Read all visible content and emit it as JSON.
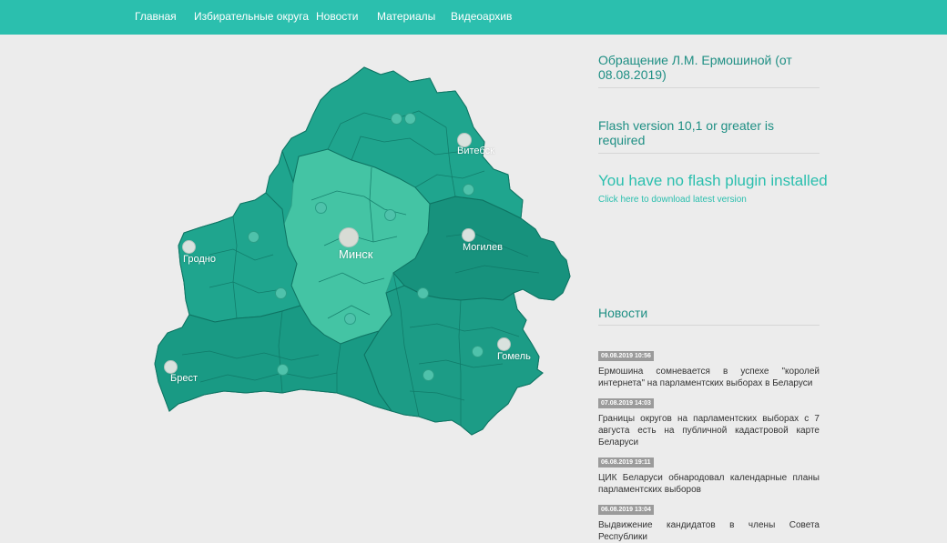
{
  "nav": {
    "items": [
      {
        "label": "Главная"
      },
      {
        "label": "Избирательные округа"
      },
      {
        "label": "Новости"
      },
      {
        "label": "Материалы"
      },
      {
        "label": "Видеоархив"
      }
    ]
  },
  "map": {
    "cities": [
      {
        "label": "Витебск"
      },
      {
        "label": "Могилев"
      },
      {
        "label": "Минск"
      },
      {
        "label": "Гродно"
      },
      {
        "label": "Брест"
      },
      {
        "label": "Гомель"
      }
    ],
    "colors": {
      "region_mid": "#1fa58e",
      "region_dark": "#17927d",
      "region_light": "#44c4a4",
      "border": "#0e7463"
    }
  },
  "sidebar": {
    "appeal_title": "Обращение Л.М. Ермошиной (от 08.08.2019)",
    "flash_required": "Flash version 10,1 or greater is required",
    "flash_missing": "You have no flash plugin installed",
    "flash_link": "Click here to download latest version",
    "news_heading": "Новости",
    "news": [
      {
        "date": "09.08.2019 10:56",
        "text": "Ермошина сомневается в успехе \"королей интернета\" на парламентских выборах в Беларуси"
      },
      {
        "date": "07.08.2019 14:03",
        "text": "Границы округов на парламентских выборах с 7 августа есть на публичной кадастровой карте Беларуси"
      },
      {
        "date": "06.08.2019 19:11",
        "text": "ЦИК Беларуси обнародовал календарные планы парламентских выборов"
      },
      {
        "date": "06.08.2019 13:04",
        "text": "Выдвижение кандидатов в члены Совета Республики"
      }
    ]
  },
  "colors": {
    "nav_bg": "#2bbfae",
    "accent": "#2bbfae",
    "heading": "#1f8f84",
    "page_bg": "#ececec"
  }
}
